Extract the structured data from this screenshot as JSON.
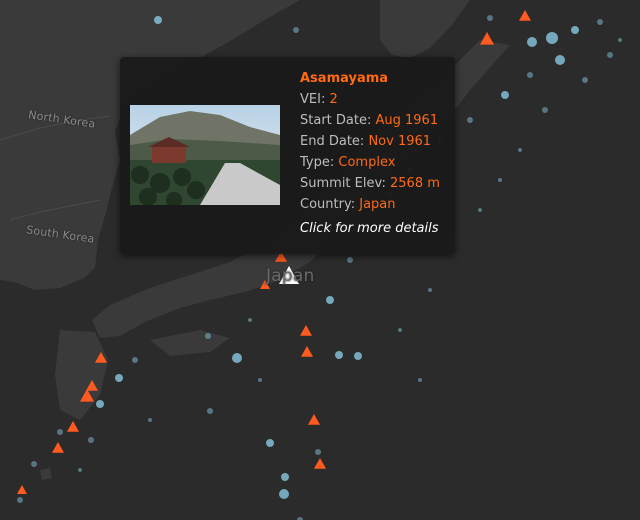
{
  "map": {
    "labels": [
      {
        "id": "north-korea",
        "text": "North Korea"
      },
      {
        "id": "south-korea",
        "text": "South Korea"
      },
      {
        "id": "japan",
        "text": "Japan"
      }
    ]
  },
  "tooltip": {
    "name": "Asamayama",
    "vei_label": "VEI:",
    "vei": "2",
    "start_label": "Start Date:",
    "start": "Aug 1961",
    "end_label": "End Date:",
    "end": "Nov 1961",
    "type_label": "Type:",
    "type": "Complex",
    "elev_label": "Summit Elev:",
    "elev": "2568 m",
    "country_label": "Country:",
    "country": "Japan",
    "more": "Click for more details"
  },
  "colors": {
    "volcano": "#ff5a1f",
    "selected": "#ffffff",
    "earthquake": "#8fd3ee",
    "land": "#3a3a3a",
    "sea": "#2b2b2b"
  }
}
